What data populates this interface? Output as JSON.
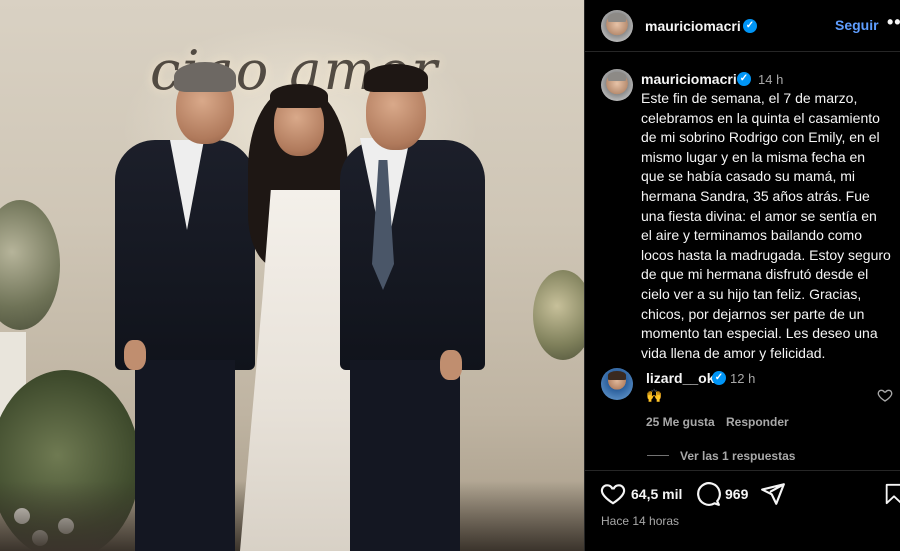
{
  "post": {
    "author": "mauriciomacri",
    "follow_label": "Seguir",
    "more_label": "•••",
    "neon_sign": "ciao amor",
    "caption": {
      "author": "mauriciomacri",
      "time": "14 h",
      "text": "Este fin de semana, el 7 de marzo, celebramos en la quinta el casamiento de mi sobrino Rodrigo con Emily, en el mismo lugar y en la misma fecha en que se había casado su mamá, mi hermana Sandra, 35 años atrás. Fue una fiesta divina: el amor se sentía en el aire y terminamos bailando como locos hasta la madrugada. Estoy seguro de que mi hermana disfrutó desde el cielo ver a su hijo tan feliz. Gracias, chicos, por dejarnos ser parte de un momento tan especial. Les deseo una vida llena de amor y felicidad."
    },
    "comment": {
      "author": "lizard__ok",
      "time": "12 h",
      "text": "🙌",
      "likes": "25 Me gusta",
      "reply_label": "Responder",
      "view_replies": "Ver las 1 respuestas"
    },
    "actions": {
      "likes": "64,5 mil",
      "comments": "969",
      "time_ago": "Hace 14 horas"
    },
    "icons": {
      "verified": "verified-badge-icon",
      "like": "heart-icon",
      "comment": "comment-bubble-icon",
      "share": "paper-plane-icon",
      "save": "bookmark-icon"
    },
    "colors": {
      "background": "#000000",
      "link_blue": "#5f9eff",
      "verified_blue": "#0095f6",
      "secondary_text": "#a8a8a8"
    }
  }
}
